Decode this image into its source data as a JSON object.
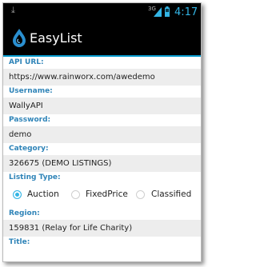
{
  "status": {
    "network": "3G",
    "time": "4:17"
  },
  "app": {
    "title": "EasyList",
    "logo_icon": "water-drop-logo-icon"
  },
  "form": {
    "api_url": {
      "label": "API URL:",
      "value": "https://www.rainworx.com/awedemo"
    },
    "username": {
      "label": "Username:",
      "value": "WallyAPI"
    },
    "password": {
      "label": "Password:",
      "value": "demo"
    },
    "category": {
      "label": "Category:",
      "value": "326675 (DEMO LISTINGS)"
    },
    "listing_type": {
      "label": "Listing Type:",
      "options": [
        "Auction",
        "FixedPrice",
        "Classified"
      ],
      "selected": "Auction"
    },
    "region": {
      "label": "Region:",
      "value": "159831 (Relay for Life Charity)"
    },
    "title": {
      "label": "Title:"
    }
  },
  "colors": {
    "accent": "#33b5e5",
    "label": "#2f84b8",
    "field_bg": "#ededed"
  }
}
